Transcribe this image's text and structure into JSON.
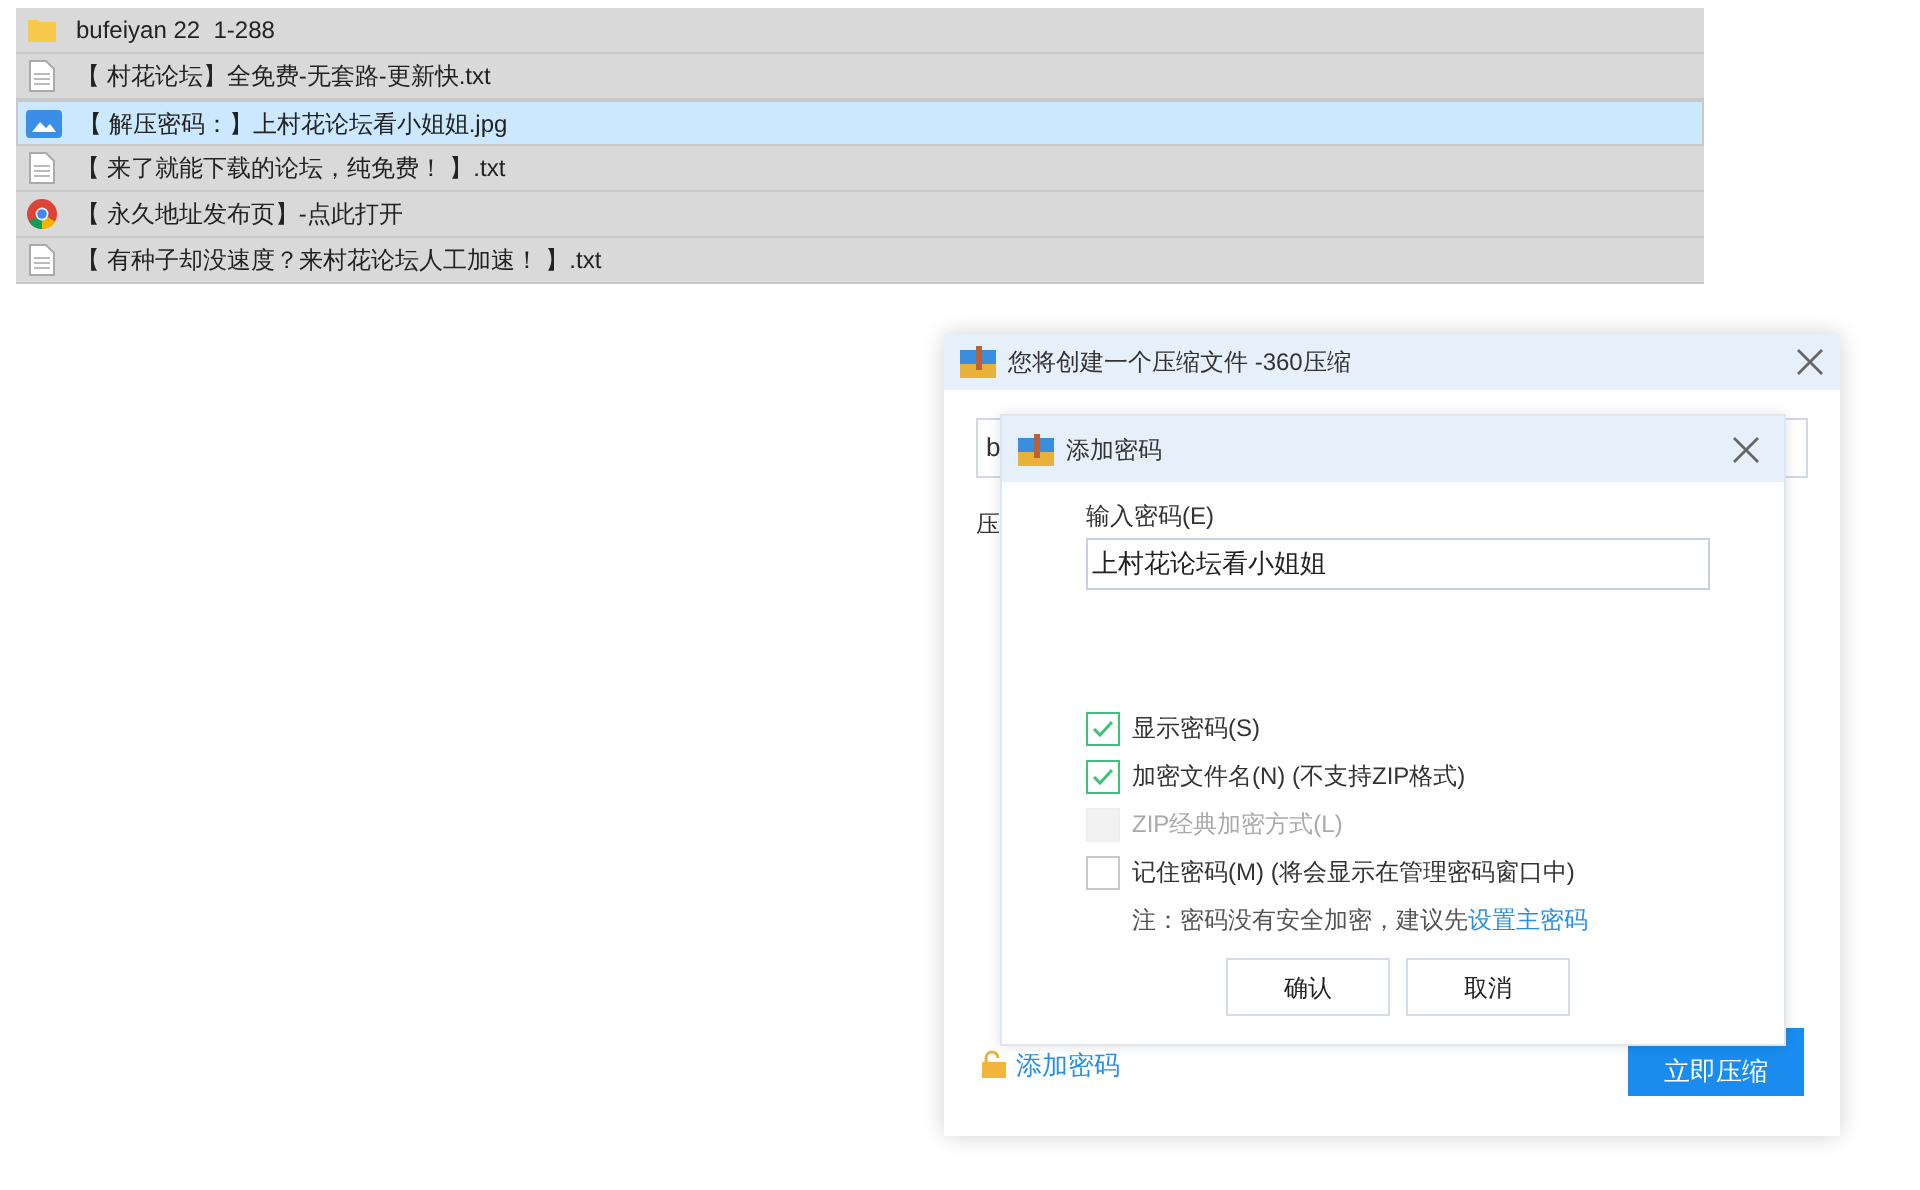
{
  "files": [
    {
      "kind": "folder",
      "name": "bufeiyan 22  1-288",
      "selected": false
    },
    {
      "kind": "text",
      "name": "【 村花论坛】全免费-无套路-更新快.txt",
      "selected": false
    },
    {
      "kind": "image",
      "name": "【 解压密码：】上村花论坛看小姐姐.jpg",
      "selected": true
    },
    {
      "kind": "text",
      "name": "【 来了就能下载的论坛，纯免费！ 】.txt",
      "selected": false
    },
    {
      "kind": "browser",
      "name": "【 永久地址发布页】-点此打开",
      "selected": false
    },
    {
      "kind": "text",
      "name": "【 有种子却没速度？来村花论坛人工加速！ 】.txt",
      "selected": false
    }
  ],
  "compress_dialog": {
    "title": "您将创建一个压缩文件 -360压缩",
    "path_value": "b",
    "label": "压",
    "add_password_link": "添加密码",
    "compress_button": "立即压缩"
  },
  "password_dialog": {
    "title": "添加密码",
    "field_label": "输入密码(E)",
    "password": "上村花论坛看小姐姐",
    "options": [
      {
        "label": "显示密码(S)",
        "checked": true,
        "disabled": false
      },
      {
        "label": "加密文件名(N) (不支持ZIP格式)",
        "checked": true,
        "disabled": false
      },
      {
        "label": "ZIP经典加密方式(L)",
        "checked": false,
        "disabled": true
      },
      {
        "label": "记住密码(M) (将会显示在管理密码窗口中)",
        "checked": false,
        "disabled": false
      }
    ],
    "note": "注：密码没有安全加密，建议先",
    "note_link": "设置主密码",
    "buttons": [
      "确认",
      "取消"
    ]
  }
}
